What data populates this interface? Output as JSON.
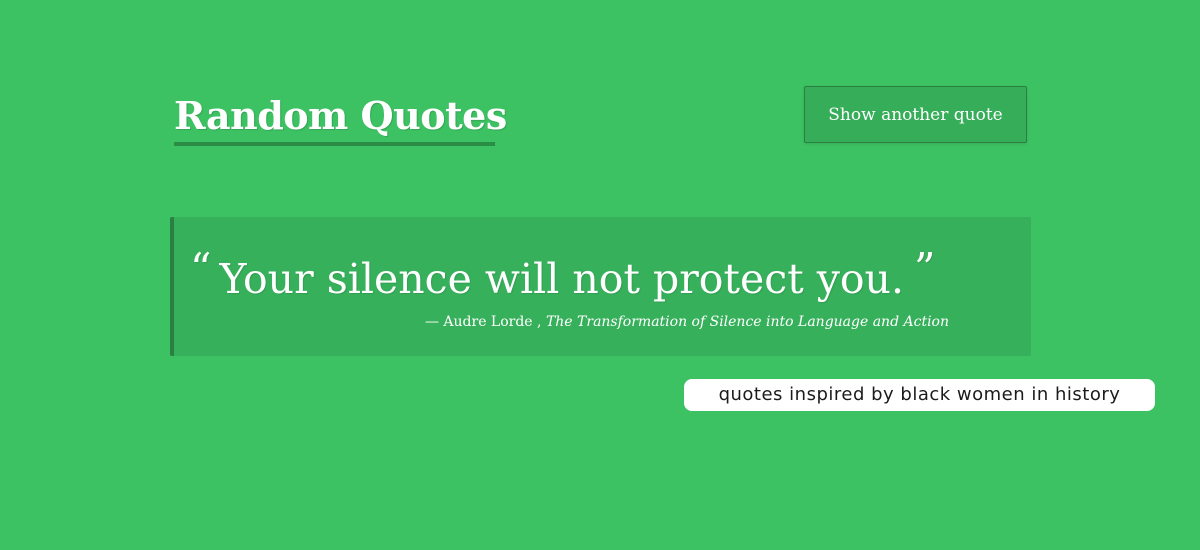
{
  "header": {
    "title": "Random Quotes",
    "show_button_label": "Show another quote"
  },
  "quote": {
    "open_mark": "“",
    "text": "Your silence will not protect you.",
    "close_mark": "”",
    "dash": "—",
    "author": "Audre Lorde",
    "separator": ",",
    "source": "The Transformation of Silence into Language and Action"
  },
  "tagline": "quotes inspired by black women in history",
  "colors": {
    "background": "#3dc263",
    "card": "#37b05b",
    "accent_dark": "#2a7f43",
    "text": "#ffffff"
  }
}
